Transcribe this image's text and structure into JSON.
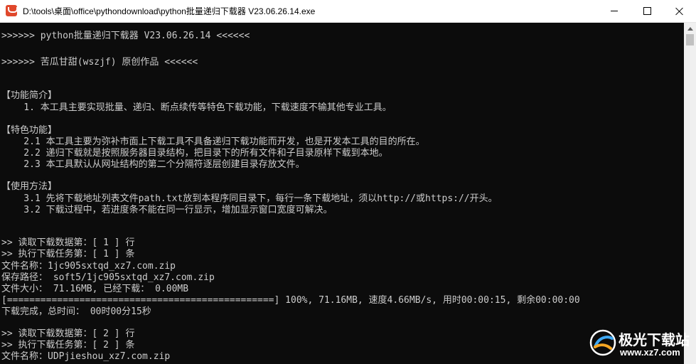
{
  "window": {
    "title": "D:\\tools\\桌面\\office\\pythondownload\\python批量递归下载器 V23.06.26.14.exe",
    "app_icon": "terminal-app-icon",
    "controls": {
      "minimize": "minimize-icon",
      "maximize": "maximize-icon",
      "close": "close-icon"
    }
  },
  "console": {
    "lines": [
      ">>>>>> python批量递归下载器 V23.06.26.14 <<<<<<",
      ">>>>>> 苦瓜甘甜(wszjf) 原创作品 <<<<<<",
      "【功能简介】",
      "    1. 本工具主要实现批量、递归、断点续传等特色下载功能，下载速度不输其他专业工具。",
      "【特色功能】",
      "    2.1 本工具主要为弥补市面上下载工具不具备递归下载功能而开发，也是开发本工具的目的所在。",
      "    2.2 递归下载就是按照服务器目录结构，把目录下的所有文件和子目录原样下载到本地。",
      "    2.3 本工具默认从网址结构的第二个分隔符逐层创建目录存放文件。",
      "【使用方法】",
      "    3.1 先将下载地址列表文件path.txt放到本程序同目录下，每行一条下载地址，须以http://或https://开头。",
      "    3.2 下载过程中，若进度条不能在同一行显示，增加显示窗口宽度可解决。",
      ">> 读取下载数据第：[ 1 ] 行",
      ">> 执行下载任务第：[ 1 ] 条",
      "文件名称：1jc905sxtqd_xz7.com.zip",
      "保存路径： soft5/1jc905sxtqd_xz7.com.zip",
      "文件大小： 71.16MB, 已经下载： 0.00MB",
      "[================================================] 100%, 71.16MB, 速度4.66MB/s, 用时00:00:15, 剩余00:00:00",
      "下载完成，总时间： 00时00分15秒",
      ">> 读取下载数据第：[ 2 ] 行",
      ">> 执行下载任务第：[ 2 ] 条",
      "文件名称：UDPjieshou_xz7.com.zip"
    ]
  },
  "watermark": {
    "brand_cn": "极光下载站",
    "url": "www.xz7.com",
    "logo_icon": "aurora-logo-icon"
  },
  "colors": {
    "console_bg": "#0c0c0c",
    "console_text": "#cccccc",
    "titlebar_bg": "#ffffff",
    "app_icon": "#e0482c"
  }
}
